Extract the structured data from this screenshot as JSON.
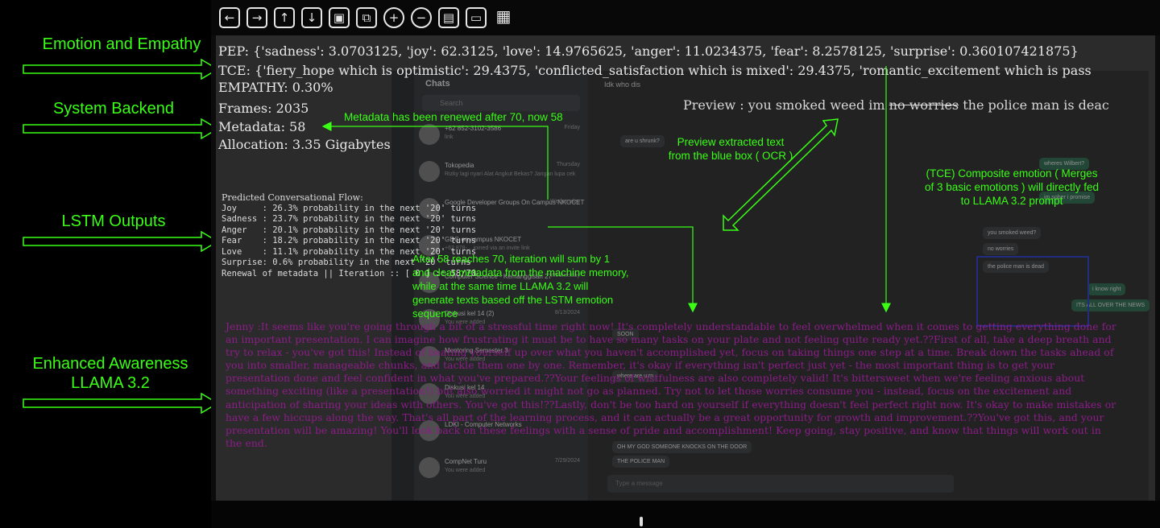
{
  "annotations_left": [
    {
      "text": "Emotion and Empathy"
    },
    {
      "text": "System Backend"
    },
    {
      "text": "LSTM Outputs"
    },
    {
      "text": "Enhanced Awareness\nLLAMA 3.2"
    }
  ],
  "toolbar": {
    "buttons": [
      {
        "icon": "arrow-left-icon",
        "glyph": "←"
      },
      {
        "icon": "arrow-right-icon",
        "glyph": "→"
      },
      {
        "icon": "arrow-up-icon",
        "glyph": "↑"
      },
      {
        "icon": "arrow-down-icon",
        "glyph": "↓"
      },
      {
        "icon": "image-icon",
        "glyph": "▣"
      },
      {
        "icon": "image-export-icon",
        "glyph": "⧉"
      },
      {
        "icon": "zoom-in-icon",
        "glyph": "+"
      },
      {
        "icon": "zoom-out-icon",
        "glyph": "−"
      },
      {
        "icon": "save-icon",
        "glyph": "▤"
      },
      {
        "icon": "window-icon",
        "glyph": "▭"
      },
      {
        "icon": "tools-icon",
        "glyph": "▦"
      }
    ]
  },
  "backend": {
    "pep": "PEP: {'sadness': 3.0703125, 'joy': 62.3125, 'love': 14.9765625, 'anger': 11.0234375, 'fear': 8.2578125, 'surprise': 0.360107421875}",
    "tce": "TCE: {'fiery_hope which is optimistic': 29.4375, 'conflicted_satisfaction which is mixed': 29.4375, 'romantic_excitement which is pass",
    "empathy": "EMPATHY: 0.30%",
    "frames": "Frames: 2035",
    "metadata": "Metadata: 58",
    "allocation": "Allocation: 3.35 Gigabytes",
    "preview_prefix": "Preview : you smoked weed im ",
    "preview_strike": "no worries",
    "preview_suffix": "  the police man is deac"
  },
  "lstm": {
    "title": "Predicted Conversational Flow:",
    "rows": [
      "Joy     : 26.3% probability in the next '20' turns",
      "Sadness : 23.7% probability in the next '20' turns",
      "Anger   : 20.1% probability in the next '20' turns",
      "Fear    : 18.2% probability in the next '20' turns",
      "Love    : 11.1% probability in the next '20' turns",
      "Surprise: 0.6% probability in the next '20' turns",
      "Renewal of metadata || Iteration :: [ 0 ] :: 58/70"
    ]
  },
  "llama_output": "Jenny :It seems like you're going through a bit of a stressful time right now! It's completely understandable to feel overwhelmed when it comes to getting everything done for an important presentation. I can imagine how frustrating it must be to have so many tasks on your plate and not feeling quite ready yet.??First of all, take a deep breath and try to relax - you've got this! Instead of beating yourself up over what you haven't accomplished yet, focus on taking things one step at a time. Break down the tasks ahead of you into smaller, manageable chunks, and tackle them one by one. Remember, it's okay if everything isn't perfect just yet - the most important thing is to get your presentation done and feel confident in what you've prepared.??Your feelings of wistfulness are also completely valid! It's bittersweet when we're feeling anxious about something exciting (like a presentation!) but also worried it might not go as planned. Try not to let those worries consume you - instead, focus on the excitement and anticipation of sharing your ideas with others. You've got this!??Lastly, don't be too hard on yourself if everything doesn't feel perfect right now. It's okay to make mistakes or have a few hiccups along the way. That's all part of the learning process, and it can actually be a great opportunity for growth and improvement.??You've got this, and your presentation will be amazing! You'll look back on these feelings with a sense of pride and accomplishment! Keep going, stay positive, and know that things will work out in the end.",
  "green_notes": {
    "metadata_note": "Metadata has been renewed after 70, now 58",
    "preview_note": "Preview extracted text\nfrom the blue box ( OCR )",
    "tce_note": "(TCE) Composite emotion ( Merges\nof 3 basic emotions ) will directly fed\nto LLAMA 3.2 prompt",
    "iteration_note": "After 58 reaches 70, iteration will sum by 1\nand clear metadata from the machine memory,\nwhile at the same time LLAMA 3.2 will\ngenerate texts based off the LSTM emotion\nsequence"
  },
  "chat_app": {
    "list_title": "Chats",
    "search_placeholder": "Search",
    "conversations": [
      {
        "name": "+62 852-3102-3586",
        "preview": "link",
        "time": "Friday"
      },
      {
        "name": "Tokopedia",
        "preview": "Rizky lagi nyari Alat Angkut Bekas? Jangan lupa cek",
        "time": "Thursday"
      },
      {
        "name": "Google Developer Groups On Campus NKOCET",
        "preview": "",
        "time": "Wednesday"
      },
      {
        "name": "GDG on campus NKOCET",
        "preview": "+62 878-... joined via an invite link",
        "time": ""
      },
      {
        "name": "Computer Science - Kemanggisan 27",
        "preview": "",
        "time": "Wednesday"
      },
      {
        "name": "Diskusi kel 14 (2)",
        "preview": "You were added",
        "time": "8/13/2024"
      },
      {
        "name": "Mentoring Semester 3",
        "preview": "You were added",
        "time": ""
      },
      {
        "name": "Diskusi kel 14",
        "preview": "You were added",
        "time": ""
      },
      {
        "name": "LDKI - Computer Networks",
        "preview": "",
        "time": ""
      },
      {
        "name": "CompNet Turu",
        "preview": "You were added",
        "time": "7/29/2024"
      }
    ],
    "header_name": "Idk who dis",
    "bubbles": [
      {
        "text": "are u shrunk?",
        "dir": "in"
      },
      {
        "text": "wheres Wilbert?",
        "dir": "out"
      },
      {
        "text": "im sober i promise",
        "dir": "out"
      },
      {
        "text": "you smoked weed?",
        "dir": "in"
      },
      {
        "text": "no worries",
        "dir": "in"
      },
      {
        "text": "the police man is dead",
        "dir": "in"
      },
      {
        "text": "i know right",
        "dir": "out"
      },
      {
        "text": "ITS ALL OVER THE NEWS",
        "dir": "out"
      },
      {
        "text": "SOON",
        "dir": "in"
      },
      {
        "text": "where are u rn",
        "dir": "in"
      },
      {
        "text": "OH MY GOD SOMEONE KNOCKS ON THE DOOR",
        "dir": "in"
      },
      {
        "text": "THE POLICE MAN",
        "dir": "in"
      }
    ],
    "input_placeholder": "Type a message"
  }
}
